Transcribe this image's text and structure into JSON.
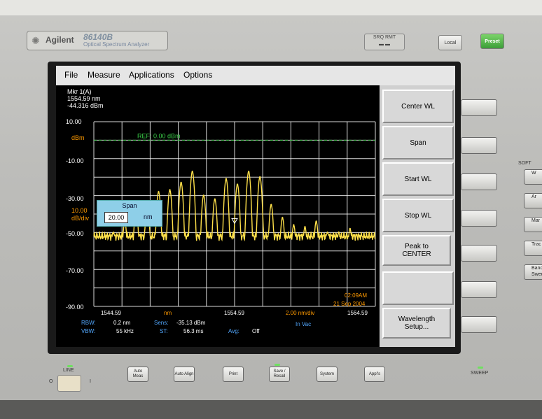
{
  "instrument": {
    "brand": "Agilent",
    "model": "86140B",
    "model_subtitle": "Optical Spectrum Analyzer",
    "srq_rmt": "SRQ  RMT",
    "local": "Local",
    "preset": "Preset",
    "sweep": "SWEEP",
    "line": "LINE",
    "power_off": "O",
    "power_on": "I",
    "softkey_label": "SOFT",
    "side_buttons": [
      "W",
      "Ar",
      "Mar",
      "Trac",
      "Band Swee"
    ]
  },
  "menu": [
    "File",
    "Measure",
    "Applications",
    "Options"
  ],
  "marker": {
    "title": "Mkr 1(A)",
    "wavelength": "1554.59 nm",
    "power": "-44.316 dBm"
  },
  "y_labels": {
    "top": "10.00",
    "unit": "dBm",
    "l1": "-10.00",
    "l2": "-30.00",
    "scale_value": "10.00",
    "scale_unit": "dB/div",
    "l3": "-50.00",
    "l4": "-70.00",
    "bottom": "-90.00"
  },
  "ref_label": "REF: 0.00 dBm",
  "span_dialog": {
    "title": "Span",
    "value": "20.00",
    "unit": "nm"
  },
  "x_labels": {
    "left": "1544.59",
    "unit": "nm",
    "center": "1554.59",
    "per_div": "2.00 nm/div",
    "right": "1564.59"
  },
  "timestamp": {
    "time": "02:09AM",
    "date": "21 Sep 2004"
  },
  "status": {
    "rbw_label": "RBW:",
    "rbw": "0.2 nm",
    "sens_label": "Sens:",
    "sens": "-35.13 dBm",
    "medium": "In Vac",
    "vbw_label": "VBW:",
    "vbw": "55 kHz",
    "st_label": "ST:",
    "st": "56.3 ms",
    "avg_label": "Avg:",
    "avg": "Off"
  },
  "softkeys": [
    "Center WL",
    "Span",
    "Start WL",
    "Stop WL",
    "Peak to CENTER",
    "",
    "Wavelength Setup..."
  ],
  "front_buttons": [
    "Auto Meas",
    "Auto Align",
    "Print",
    "Save / Recall",
    "System",
    "Appl's"
  ],
  "colors": {
    "trace": "#ffe14a",
    "ref_line": "#3bd14a",
    "grid": "#ffffff",
    "status_key": "#52a8ff",
    "accent_orange": "#ff9a00"
  },
  "chart_data": {
    "type": "line",
    "xlabel": "nm",
    "ylabel": "dBm",
    "xlim": [
      1544.59,
      1564.59
    ],
    "ylim": [
      -90,
      10
    ],
    "grid": true,
    "reference_level": 0.0,
    "noise_floor": -52,
    "series": [
      {
        "peaks": [
          {
            "x": 1545.99,
            "y": -50
          },
          {
            "x": 1546.79,
            "y": -44
          },
          {
            "x": 1547.59,
            "y": -37
          },
          {
            "x": 1548.39,
            "y": -34
          },
          {
            "x": 1549.19,
            "y": -28
          },
          {
            "x": 1549.99,
            "y": -27
          },
          {
            "x": 1550.79,
            "y": -23
          },
          {
            "x": 1551.59,
            "y": -17
          },
          {
            "x": 1552.39,
            "y": -30
          },
          {
            "x": 1553.19,
            "y": -32
          },
          {
            "x": 1553.99,
            "y": -21
          },
          {
            "x": 1554.79,
            "y": -24
          },
          {
            "x": 1555.59,
            "y": -17
          },
          {
            "x": 1556.39,
            "y": -20
          },
          {
            "x": 1557.19,
            "y": -35
          },
          {
            "x": 1557.99,
            "y": -42
          },
          {
            "x": 1558.79,
            "y": -46
          },
          {
            "x": 1559.59,
            "y": -47
          },
          {
            "x": 1560.39,
            "y": -44
          },
          {
            "x": 1561.19,
            "y": -50
          },
          {
            "x": 1561.99,
            "y": -50
          },
          {
            "x": 1562.79,
            "y": -48
          }
        ]
      }
    ]
  }
}
